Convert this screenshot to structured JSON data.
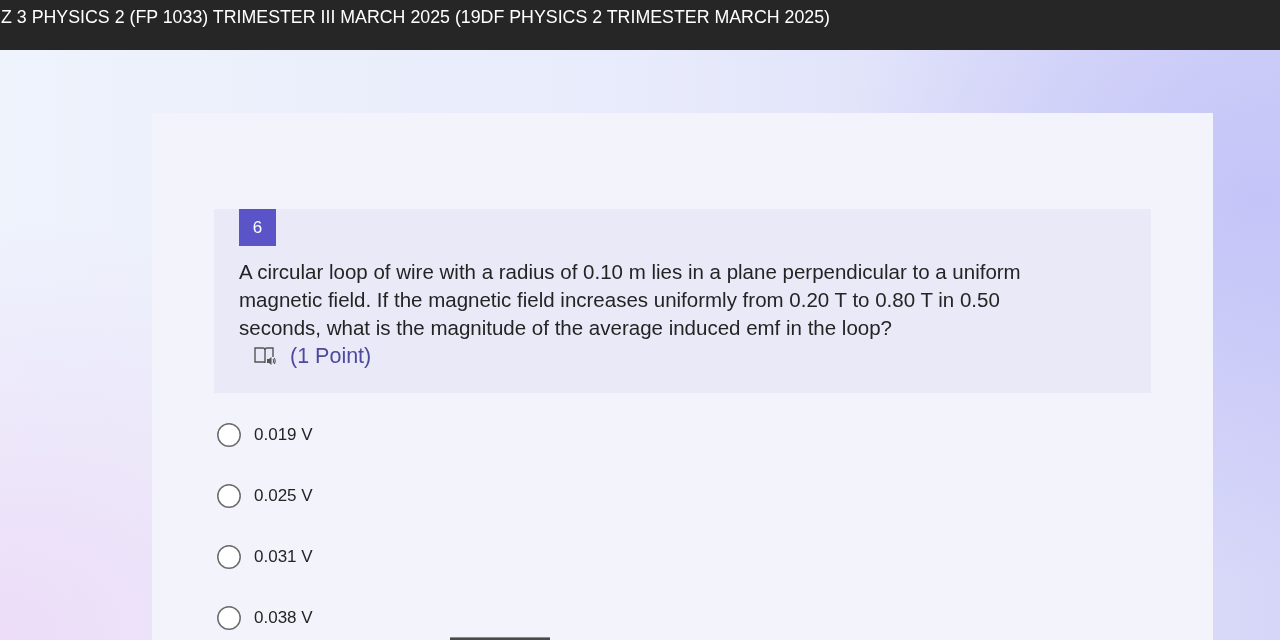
{
  "header": {
    "title": "Z 3 PHYSICS 2 (FP 1033) TRIMESTER III MARCH 2025 (19DF PHYSICS 2 TRIMESTER MARCH 2025)"
  },
  "question": {
    "number": "6",
    "text": "A circular loop of wire with a radius of 0.10 m lies in a plane perpendicular to a uniform magnetic field. If the magnetic field increases uniformly from 0.20 T to 0.80 T in 0.50 seconds, what is the magnitude of the average induced emf in the loop?",
    "points": "(1 Point)"
  },
  "options": [
    {
      "label": "0.019 V",
      "selected": false
    },
    {
      "label": "0.025 V",
      "selected": false
    },
    {
      "label": "0.031 V",
      "selected": false
    },
    {
      "label": "0.038 V",
      "selected": false
    }
  ]
}
